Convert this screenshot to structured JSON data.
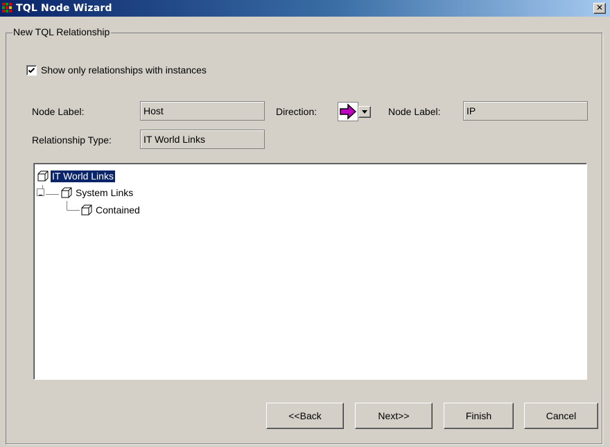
{
  "window": {
    "title": "TQL Node Wizard",
    "close_label": "✕"
  },
  "group": {
    "title": "New TQL Relationship"
  },
  "filter": {
    "show_only_with_instances_label": "Show only relationships with instances",
    "checked": true
  },
  "fields": {
    "node_label_left_caption": "Node Label:",
    "node_label_left_value": "Host",
    "direction_caption": "Direction:",
    "node_label_right_caption": "Node Label:",
    "node_label_right_value": "IP",
    "relationship_type_caption": "Relationship Type:",
    "relationship_type_value": "IT World Links"
  },
  "tree": {
    "nodes": [
      {
        "label": "IT World Links",
        "selected": true
      },
      {
        "label": "System Links",
        "selected": false
      },
      {
        "label": "Contained",
        "selected": false
      }
    ]
  },
  "buttons": {
    "back": "<<Back",
    "next": "Next>>",
    "finish": "Finish",
    "cancel": "Cancel"
  },
  "colors": {
    "selection": "#0a246a",
    "arrow": "#c000c0",
    "dialog_bg": "#d4d0c8"
  }
}
